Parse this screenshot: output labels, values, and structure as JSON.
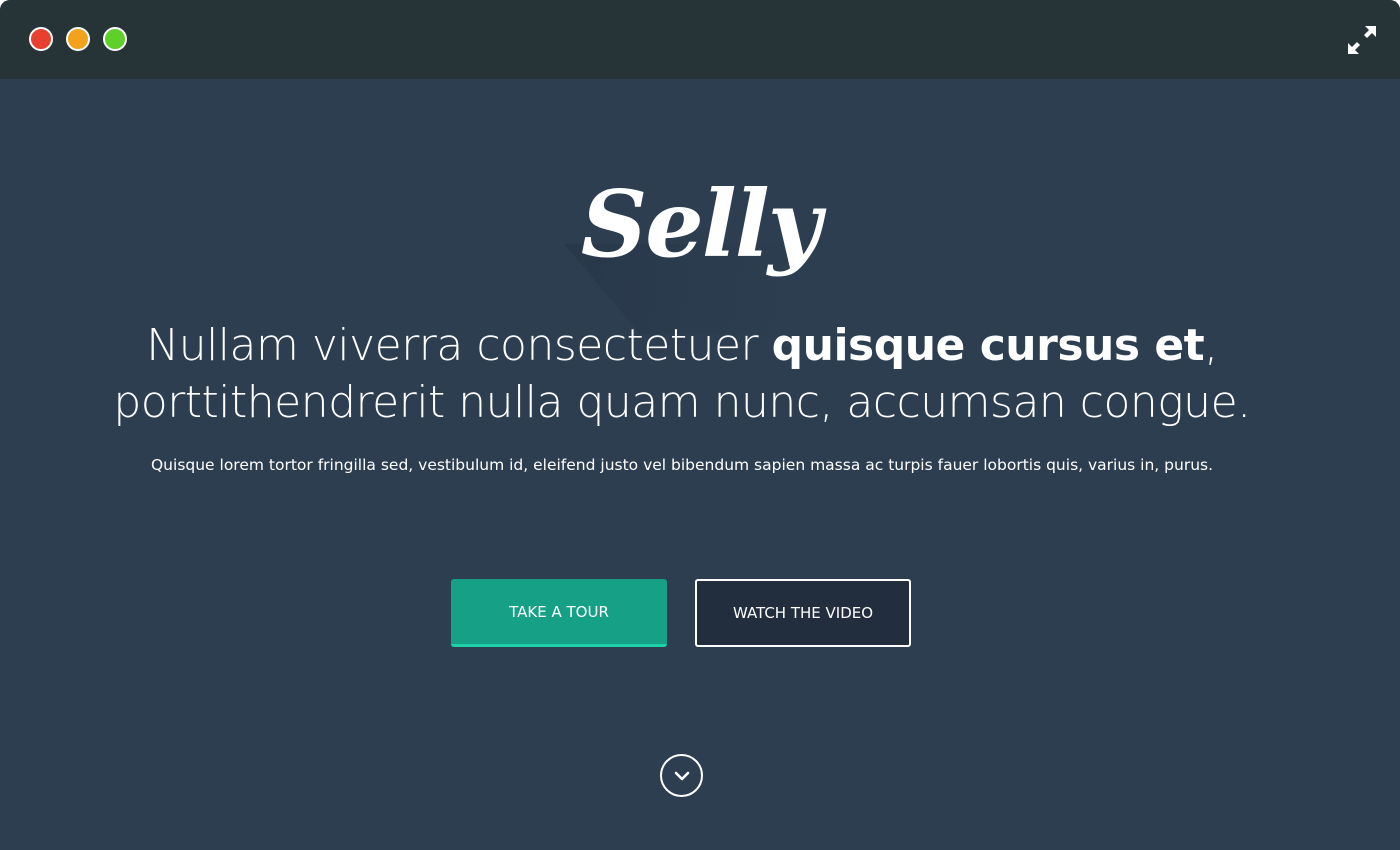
{
  "window": {
    "controls": [
      "close",
      "minimize",
      "maximize"
    ],
    "expand_icon": "expand-arrows-icon"
  },
  "hero": {
    "logo_text": "Selly",
    "headline": {
      "line1_regular": "Nullam viverra consectetuer ",
      "line1_bold": "quisque cursus et",
      "line1_end": ",",
      "line2": "porttithendrerit nulla quam nunc, accumsan congue."
    },
    "subline": "Quisque lorem tortor fringilla sed, vestibulum id, eleifend justo vel bibendum sapien massa ac turpis fauer lobortis quis, varius in, purus.",
    "buttons": {
      "tour_label": "TAKE A TOUR",
      "video_label": "WATCH THE VIDEO"
    },
    "scroll_icon": "chevron-down-circle-icon"
  },
  "colors": {
    "titlebar": "#263438",
    "background": "#2d3e51",
    "accent": "#16a085",
    "accent_border": "#1fd1a8",
    "secondary_button": "#222e3d",
    "close": "#e8402e",
    "minimize": "#f2a21d",
    "maximize": "#5fcf2a"
  }
}
